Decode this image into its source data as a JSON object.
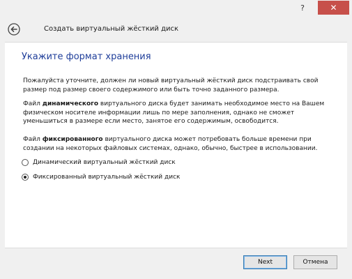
{
  "window": {
    "help_label": "?",
    "close_label": "✕"
  },
  "header": {
    "title": "Создать виртуальный жёсткий диск",
    "back_icon": "back-arrow-icon"
  },
  "page": {
    "title": "Укажите формат хранения",
    "para1": "Пожалуйста уточните, должен ли новый виртуальный жёсткий диск подстраивать свой размер под размер своего содержимого или быть точно заданного размера.",
    "para2_pre": "Файл ",
    "para2_bold": "динамического",
    "para2_post": " виртуального диска будет занимать необходимое место на Вашем физическом носителе информации лишь по мере заполнения, однако не сможет уменьшиться в размере если место, занятое его содержимым, освободится.",
    "para3_pre": "Файл ",
    "para3_bold": "фиксированного",
    "para3_post": " виртуального диска может потребовать больше времени при создании на некоторых файловых системах, однако, обычно, быстрее в использовании."
  },
  "options": [
    {
      "label": "Динамический виртуальный жёсткий диск",
      "selected": false
    },
    {
      "label": "Фиксированный виртуальный жёсткий диск",
      "selected": true
    }
  ],
  "footer": {
    "next_label": "Next",
    "cancel_label": "Отмена"
  }
}
